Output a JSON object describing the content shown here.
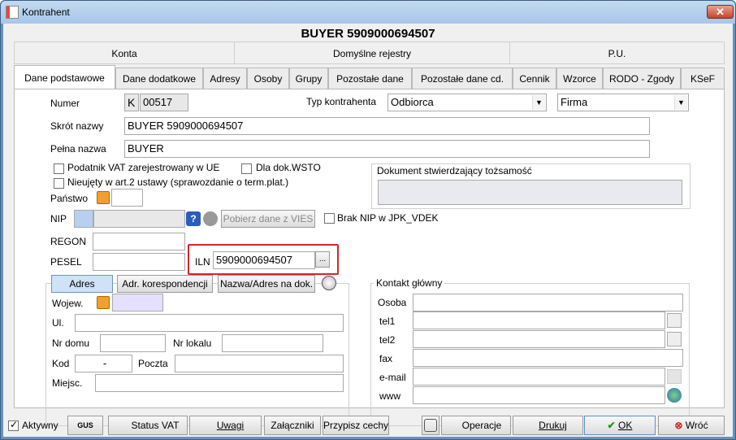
{
  "window": {
    "title": "Kontrahent",
    "close_label": "✕"
  },
  "header": {
    "title": "BUYER 5909000694507"
  },
  "groups": [
    "Konta",
    "Domyślne rejestry",
    "P.U."
  ],
  "tabs": [
    "Dane podstawowe",
    "Dane dodatkowe",
    "Adresy",
    "Osoby",
    "Grupy",
    "Pozostałe dane",
    "Pozostałe dane cd.",
    "Cennik",
    "Wzorce",
    "RODO - Zgody",
    "KSeF"
  ],
  "form": {
    "numer_label": "Numer",
    "numer_prefix": "K",
    "numer_value": "00517",
    "typ_label": "Typ kontrahenta",
    "typ_value": "Odbiorca",
    "typ2_value": "Firma",
    "skrot_label": "Skrót nazwy",
    "skrot_value": "BUYER 5909000694507",
    "pelna_label": "Pełna nazwa",
    "pelna_value": "BUYER",
    "vat_ue_label": "Podatnik VAT zarejestrowany  w UE",
    "wsto_label": "Dla dok.WSTO",
    "nieujety_label": "Nieujęty w art.2 ustawy (sprawozdanie o term.plat.)",
    "panstwo_label": "Państwo",
    "nip_label": "NIP",
    "vies_button": "Pobierz dane z VIES",
    "brak_nip_label": "Brak NIP w JPK_VDEK",
    "regon_label": "REGON",
    "pesel_label": "PESEL",
    "iln_label": "ILN",
    "iln_value": "5909000694507",
    "iln_button": "...",
    "dokument_title": "Dokument stwierdzający tożsamość"
  },
  "address": {
    "tab_adres": "Adres",
    "tab_koresp": "Adr. korespondencji",
    "tab_nazwa": "Nazwa/Adres na dok.",
    "wojew_label": "Wojew.",
    "ul_label": "Ul.",
    "nr_domu_label": "Nr domu",
    "nr_lokalu_label": "Nr lokalu",
    "kod_label": "Kod",
    "kod_value": "-",
    "poczta_label": "Poczta",
    "miejsc_label": "Miejsc."
  },
  "contact": {
    "title": "Kontakt główny",
    "osoba_label": "Osoba",
    "tel1_label": "tel1",
    "tel2_label": "tel2",
    "fax_label": "fax",
    "email_label": "e-mail",
    "www_label": "www"
  },
  "bottom": {
    "aktywny_label": "Aktywny",
    "gus_label": "GUS",
    "status_vat_label": "Status VAT",
    "uwagi_label": "Uwagi",
    "zalaczniki_label": "Załączniki",
    "przypisz_label": "Przypisz cechy",
    "operacje_label": "Operacje",
    "drukuj_label": "Drukuj",
    "ok_label": "OK",
    "wroc_label": "Wróć"
  },
  "colors": {
    "highlight_border": "#d9242a",
    "adres_tab_bg": "#cfe2f8",
    "wojew_field_bg": "#e6e0ff"
  }
}
